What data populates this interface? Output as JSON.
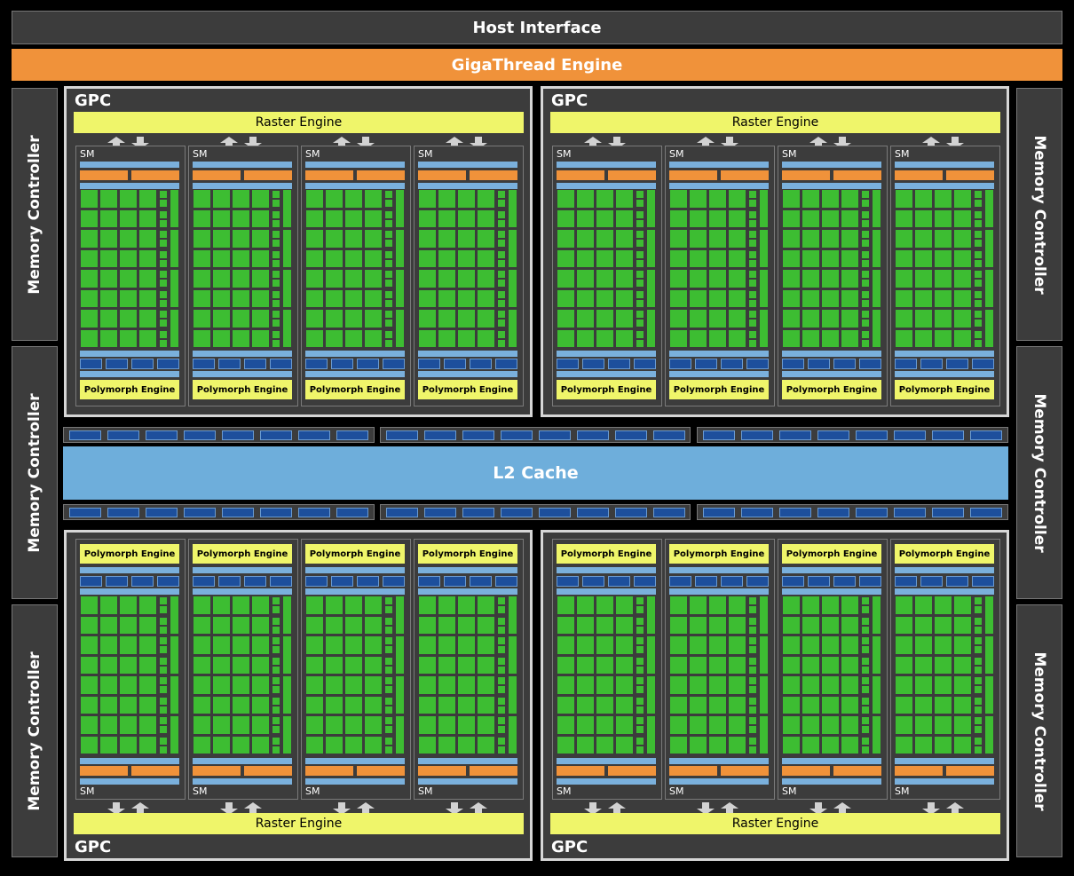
{
  "host_interface": "Host Interface",
  "gigathread_engine": "GigaThread Engine",
  "memory_controller": "Memory Controller",
  "l2_cache": "L2 Cache",
  "gpc_label": "GPC",
  "raster_engine": "Raster Engine",
  "polymorph_engine": "Polymorph Engine",
  "sm_label": "SM",
  "colors": {
    "background": "#000000",
    "block": "#3c3c3c",
    "gigathread": "#f0923a",
    "raster": "#eff56a",
    "cuda_core": "#3dbd32",
    "l2": "#6eaedb",
    "register": "#1d4f9c"
  }
}
